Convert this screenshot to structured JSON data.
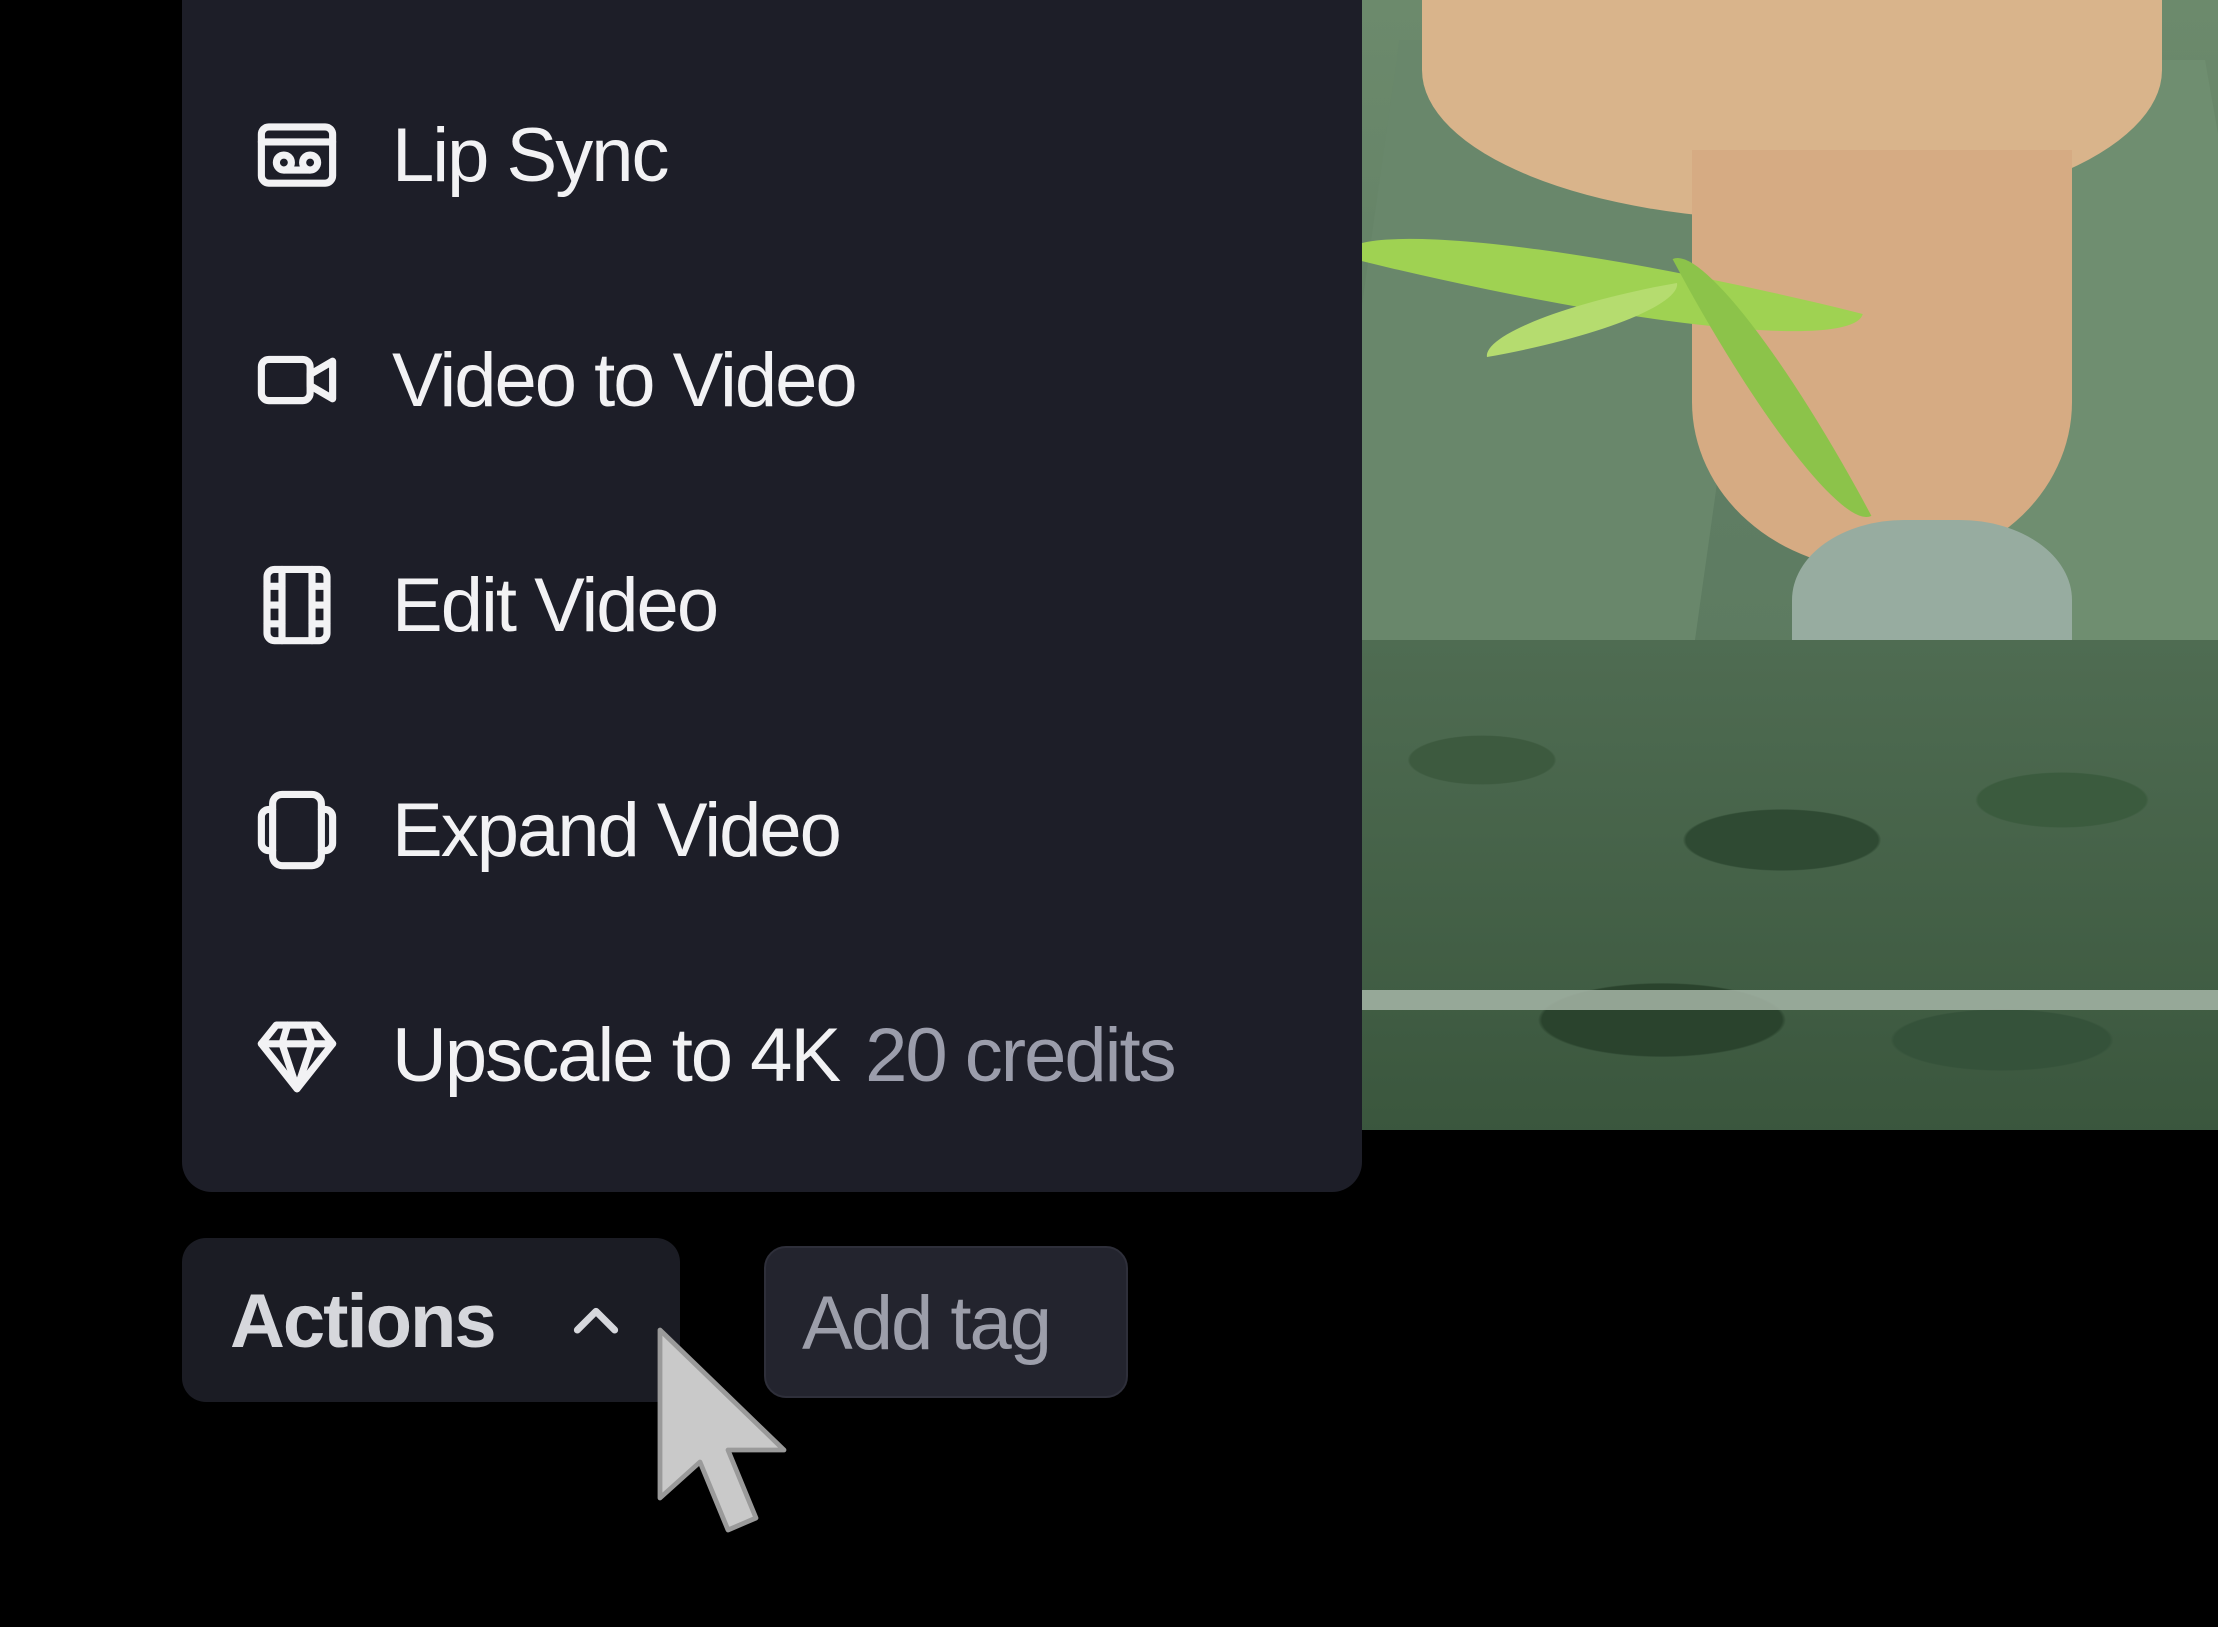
{
  "menu": {
    "items": [
      {
        "label": "Lip Sync",
        "icon": "lip-sync-icon"
      },
      {
        "label": "Video to Video",
        "icon": "video-camera-icon"
      },
      {
        "label": "Edit Video",
        "icon": "film-strip-icon"
      },
      {
        "label": "Expand Video",
        "icon": "expand-frame-icon"
      },
      {
        "label": "Upscale to 4K",
        "icon": "diamond-icon",
        "credits": "20 credits"
      }
    ]
  },
  "toolbar": {
    "actions_label": "Actions",
    "actions_icon": "chevron-up-icon",
    "add_tag_label": "Add tag"
  },
  "colors": {
    "menu_bg": "#1d1e28",
    "text": "#f2f2f4",
    "muted": "#9b9dab"
  }
}
